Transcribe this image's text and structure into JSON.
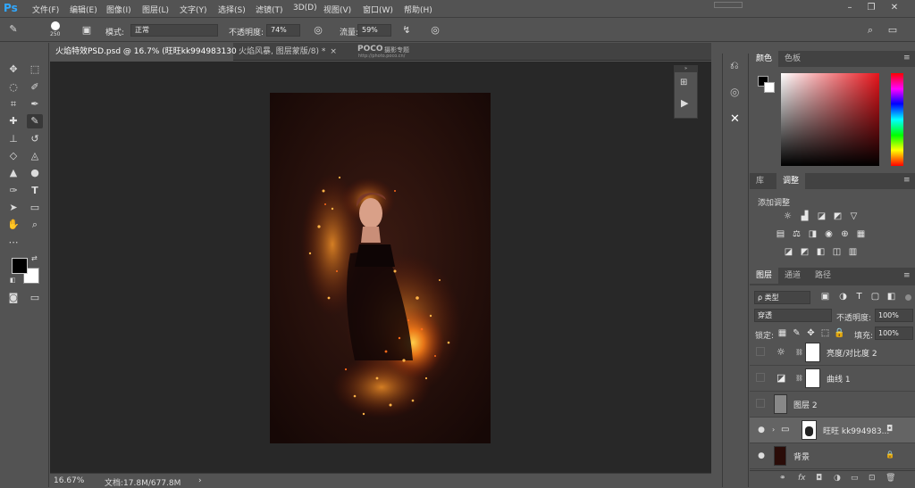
{
  "app": {
    "logo": "Ps"
  },
  "menu": [
    "文件(F)",
    "编辑(E)",
    "图像(I)",
    "图层(L)",
    "文字(Y)",
    "选择(S)",
    "滤镜(T)",
    "3D(D)",
    "视图(V)",
    "窗口(W)",
    "帮助(H)"
  ],
  "window_controls": {
    "minimize": "–",
    "restore": "❐",
    "close": "✕"
  },
  "options": {
    "brush_size": "250",
    "mode_label": "模式:",
    "mode_value": "正常",
    "opacity_label": "不透明度:",
    "opacity_value": "74%",
    "flow_label": "流量:",
    "flow_value": "59%"
  },
  "tabs": [
    {
      "label": "火焰特效PSD.psd @ 16.7% (旺旺kk994983130",
      "active": true
    },
    {
      "label": "火焰风暴, 图层蒙版/8) *",
      "active": false,
      "close": "×"
    }
  ],
  "watermark": {
    "brand": "POCO",
    "sub": "摄影专题",
    "url": "http://photo.poco.cn/"
  },
  "status": {
    "zoom": "16.67%",
    "doc": "文档:17.8M/677.8M",
    "arrow": "›"
  },
  "color_panel": {
    "tabs": [
      "颜色",
      "色板"
    ],
    "active": 0
  },
  "adjust_panel": {
    "tabs": [
      "库",
      "调整"
    ],
    "active": 1,
    "title": "添加调整"
  },
  "layers_panel": {
    "tabs": [
      "图层",
      "通道",
      "路径"
    ],
    "active": 0,
    "filter_label": "ρ 类型",
    "blend_mode": "穿透",
    "opacity_label": "不透明度:",
    "opacity_value": "100%",
    "lock_label": "锁定:",
    "fill_label": "填充:",
    "fill_value": "100%",
    "layers": [
      {
        "name": "亮度/对比度 2",
        "visible": false,
        "type": "adjust",
        "icon": "☼"
      },
      {
        "name": "曲线 1",
        "visible": false,
        "type": "adjust",
        "icon": "◪"
      },
      {
        "name": "图层 2",
        "visible": false,
        "type": "gray"
      },
      {
        "name": "旺旺 kk994983...",
        "visible": true,
        "type": "group",
        "selected": true
      },
      {
        "name": "背景",
        "visible": true,
        "type": "bg",
        "lock": "🔒"
      }
    ],
    "footer_icons": [
      "⚭",
      "fx",
      "◘",
      "◑",
      "▭",
      "⊡",
      "🗑"
    ]
  }
}
